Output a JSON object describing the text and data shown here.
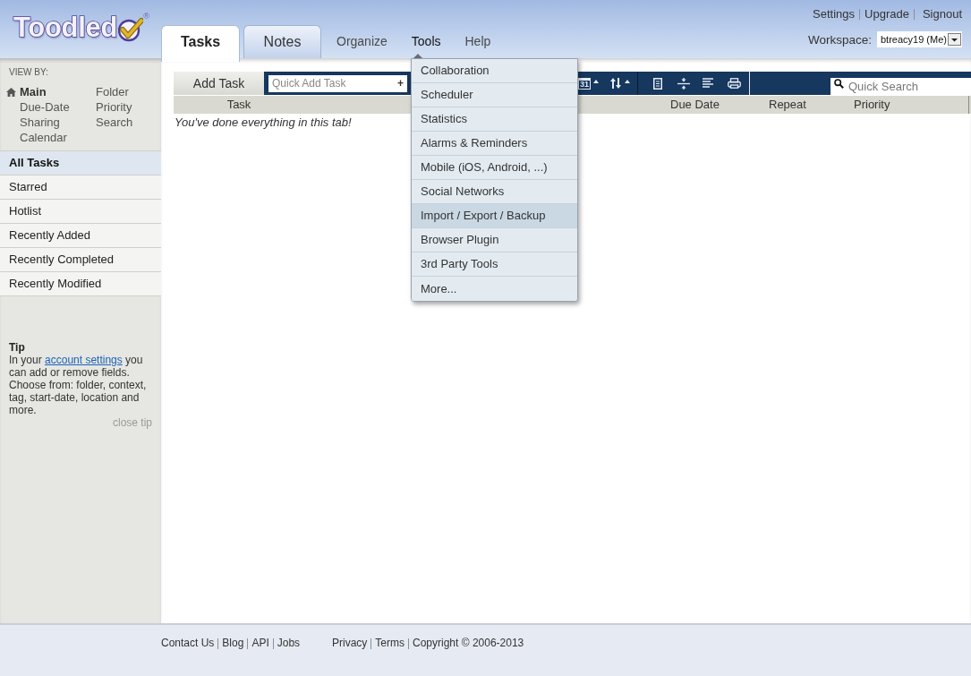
{
  "header": {
    "logo": {
      "wordmark": "Toodled",
      "registered_mark": "®"
    },
    "tabs": [
      {
        "label": "Tasks",
        "selected": true
      },
      {
        "label": "Notes",
        "selected": false
      }
    ],
    "nav": [
      {
        "label": "Organize",
        "selected": false
      },
      {
        "label": "Tools",
        "selected": true
      },
      {
        "label": "Help",
        "selected": false
      }
    ],
    "account_links": [
      "Settings",
      "Upgrade",
      "Signout"
    ],
    "workspace": {
      "label": "Workspace:",
      "value": "btreacy19 (Me)"
    }
  },
  "sidebar": {
    "view_by": {
      "heading": "VIEW BY:",
      "views": [
        {
          "label": "Main",
          "selected": true
        },
        {
          "label": "Folder",
          "selected": false
        },
        {
          "label": "Due-Date",
          "selected": false
        },
        {
          "label": "Priority",
          "selected": false
        },
        {
          "label": "Sharing",
          "selected": false
        },
        {
          "label": "Search",
          "selected": false
        },
        {
          "label": "Calendar",
          "selected": false
        }
      ]
    },
    "lists": [
      {
        "label": "All Tasks",
        "selected": true
      },
      {
        "label": "Starred",
        "selected": false
      },
      {
        "label": "Hotlist",
        "selected": false
      },
      {
        "label": "Recently Added",
        "selected": false
      },
      {
        "label": "Recently Completed",
        "selected": false
      },
      {
        "label": "Recently Modified",
        "selected": false
      }
    ],
    "tip": {
      "title": "Tip",
      "text_before": "In your",
      "link": "account settings",
      "text_after": "you can add or remove fields. Choose from: folder, context, tag, start-date, location and more.",
      "close": "close tip"
    }
  },
  "main": {
    "toolbar": {
      "add_task": "Add Task",
      "quick_add": {
        "placeholder": "Quick Add Task",
        "expand_button": "+"
      },
      "calendar_button": "31",
      "search": {
        "placeholder": "Quick Search"
      }
    },
    "task_table": {
      "columns": [
        "Task",
        "Due Date",
        "Repeat",
        "Priority"
      ],
      "empty_message": "You've done everything in this tab!"
    }
  },
  "tools_menu": {
    "items": [
      {
        "label": "Collaboration",
        "highlighted": false
      },
      {
        "label": "Scheduler",
        "highlighted": false
      },
      {
        "label": "Statistics",
        "highlighted": false
      },
      {
        "label": "Alarms & Reminders",
        "highlighted": false
      },
      {
        "label": "Mobile (iOS, Android, ...)",
        "highlighted": false
      },
      {
        "label": "Social Networks",
        "highlighted": false
      },
      {
        "label": "Import / Export / Backup",
        "highlighted": true
      },
      {
        "label": "Browser Plugin",
        "highlighted": false
      },
      {
        "label": "3rd Party Tools",
        "highlighted": false
      },
      {
        "label": "More...",
        "highlighted": false
      }
    ]
  },
  "footer": {
    "left_links": [
      "Contact Us",
      "Blog",
      "API",
      "Jobs"
    ],
    "right_links": [
      "Privacy",
      "Terms"
    ],
    "copyright": "Copyright © 2006-2013"
  }
}
